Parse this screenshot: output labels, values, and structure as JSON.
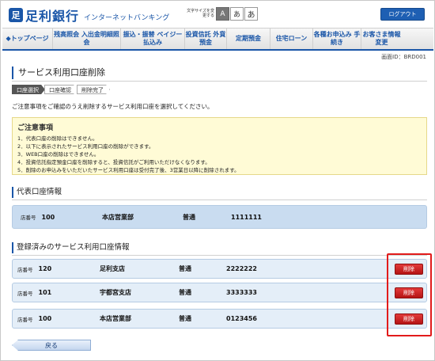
{
  "header": {
    "logo_mark": "足",
    "bank_name": "足利銀行",
    "service_name": "インターネットバンキング",
    "fontsize_label": "文字サイズを変更する",
    "fontsize_options": [
      "A",
      "あ",
      "あ"
    ],
    "logout_label": "ログアウト"
  },
  "nav": {
    "items": [
      {
        "label": "◆トップページ"
      },
      {
        "label": "残高照会 入出金明細照会"
      },
      {
        "label": "振込・振替 ペイジー払込み"
      },
      {
        "label": "投資信託 外貨預金"
      },
      {
        "label": "定期預金"
      },
      {
        "label": "住宅ローン"
      },
      {
        "label": "各種お申込み 手続き"
      },
      {
        "label": "お客さま情報 変更"
      }
    ]
  },
  "screen_id": "画面ID：BRD001",
  "page_title": "サービス利用口座削除",
  "steps": [
    "口座選択",
    "口座確認",
    "削除完了"
  ],
  "intro": "ご注意事項をご確認のうえ削除するサービス利用口座を選択してください。",
  "notice": {
    "title": "ご注意事項",
    "items": [
      "1．代表口座の削除はできません。",
      "2．以下に表示されたサービス利用口座の削除ができます。",
      "3．WEB口座の削除はできません。",
      "4．投資信託指定預金口座を削除すると、投資信託がご利用いただけなくなります。",
      "5．削除のお申込みをいただいたサービス利用口座は受付完了後、3営業日以降に削除されます。"
    ]
  },
  "rep_section": {
    "heading": "代表口座情報",
    "branch_label": "店番号",
    "branch_no": "100",
    "branch_name": "本店営業部",
    "type": "普通",
    "account_no": "1111111"
  },
  "reg_section": {
    "heading": "登録済みのサービス利用口座情報",
    "branch_label": "店番号",
    "delete_label": "削除",
    "rows": [
      {
        "branch_no": "120",
        "branch_name": "足利支店",
        "type": "普通",
        "account_no": "2222222"
      },
      {
        "branch_no": "101",
        "branch_name": "宇都宮支店",
        "type": "普通",
        "account_no": "3333333"
      },
      {
        "branch_no": "100",
        "branch_name": "本店営業部",
        "type": "普通",
        "account_no": "0123456"
      }
    ]
  },
  "back_label": "戻る",
  "colors": {
    "brand": "#1a56a8",
    "delete": "#c51d1d",
    "highlight": "#e21b1b"
  }
}
